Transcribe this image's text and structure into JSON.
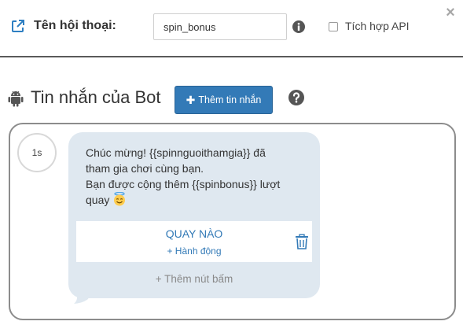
{
  "header": {
    "edit_icon": "external-link-icon",
    "dialog_name_label": "Tên hội thoại:",
    "dialog_name_value": "spin_bonus",
    "info_icon": "info-circle-icon",
    "api_checkbox_checked": false,
    "api_label": "Tích hợp API",
    "close_symbol": "×"
  },
  "section": {
    "icon": "android-icon",
    "title": "Tin nhắn của Bot",
    "add_message_button": "Thêm tin nhắn",
    "help_icon": "question-circle-icon"
  },
  "message": {
    "delay": "1s",
    "lines": [
      "Chúc mừng! {{spinnguoithamgia}} đã",
      "tham gia chơi cùng bạn.",
      "Bạn được cộng thêm {{spinbonus}} lượt",
      "quay"
    ],
    "emoji": "smiling-face-with-halo",
    "buttons": [
      {
        "label": "QUAY NÀO",
        "action": "+ Hành động",
        "delete_icon": "trash-icon"
      }
    ],
    "add_button_label": "+ Thêm nút bấm"
  },
  "colors": {
    "primary": "#337ab7",
    "bubble": "#dfe8f0",
    "panel_border": "#8c8c8c"
  }
}
